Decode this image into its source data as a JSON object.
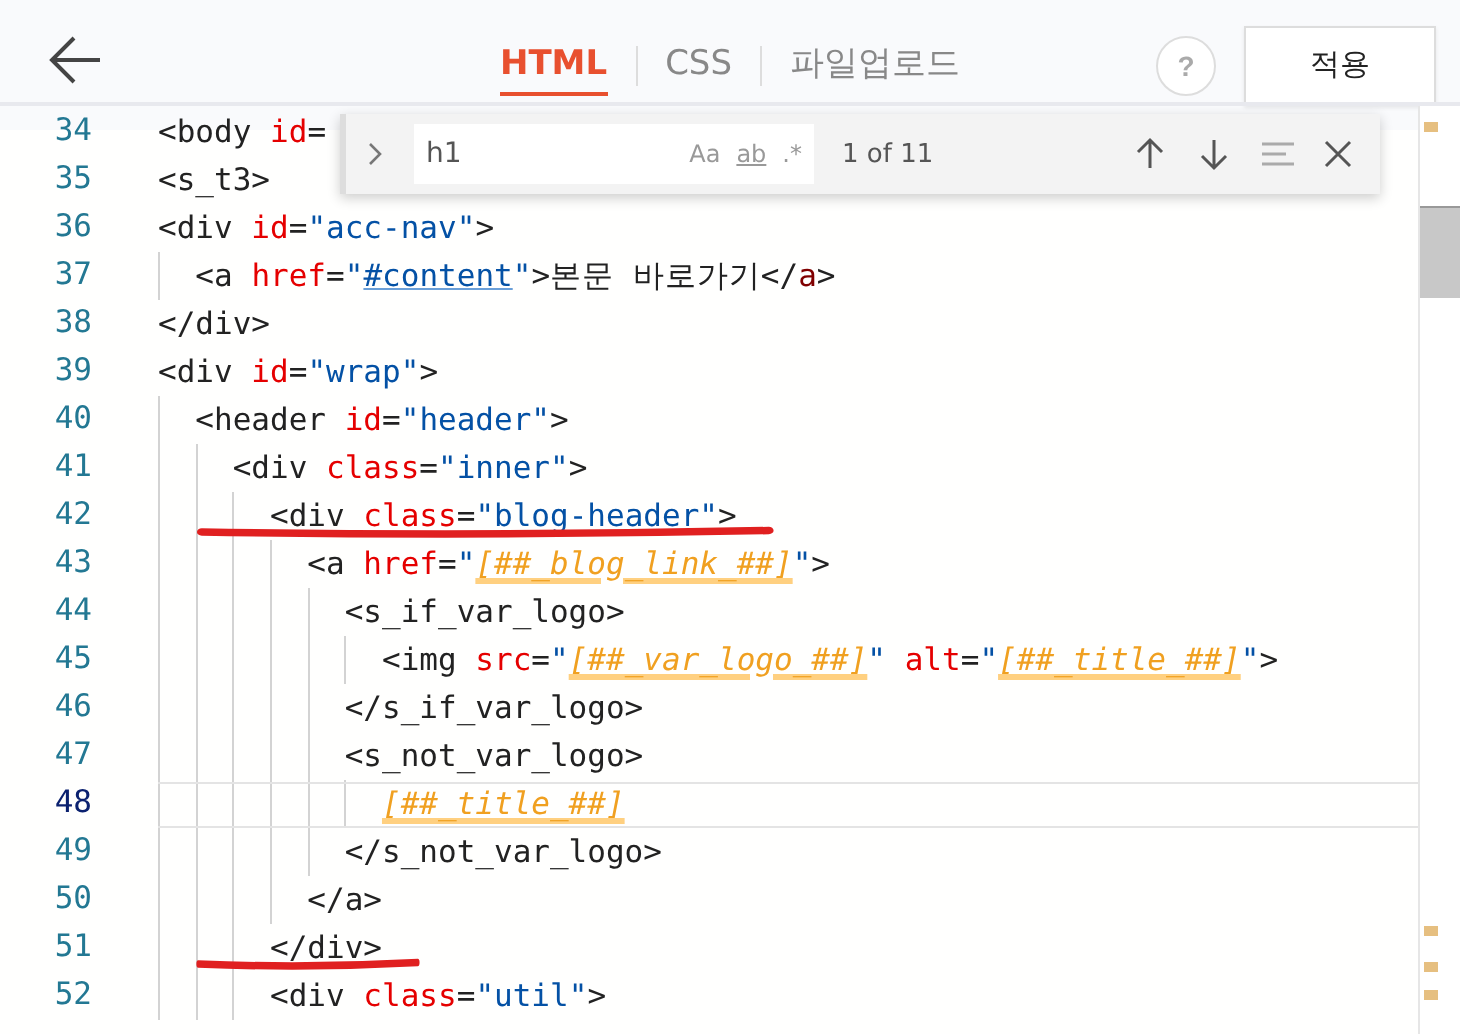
{
  "header": {
    "tabs": [
      {
        "label": "HTML",
        "selected": true
      },
      {
        "label": "CSS",
        "selected": false
      },
      {
        "label": "파일업로드",
        "selected": false
      }
    ],
    "help": "?",
    "apply_button": "적용"
  },
  "find_widget": {
    "value": "h1",
    "options": [
      "Aa",
      "ab",
      ".*"
    ],
    "result": "1 of 11"
  },
  "editor": {
    "lines": [
      {
        "number": "34",
        "current": false,
        "underlined": false,
        "tokens": [
          {
            "kind": "tag",
            "text": "<body"
          },
          {
            "kind": "attr",
            "text": " id"
          },
          {
            "kind": "punct",
            "text": "="
          }
        ]
      },
      {
        "number": "35",
        "current": false,
        "underlined": false,
        "tokens": [
          {
            "kind": "tag",
            "text": "<s_t3>"
          }
        ]
      },
      {
        "number": "36",
        "current": false,
        "underlined": false,
        "tokens": [
          {
            "kind": "tag",
            "text": "<div"
          },
          {
            "kind": "attr",
            "text": " id"
          },
          {
            "kind": "punct",
            "text": "="
          },
          {
            "kind": "str",
            "text": "\"acc-nav\""
          },
          {
            "kind": "tag",
            "text": ">"
          }
        ]
      },
      {
        "number": "37",
        "current": false,
        "underlined": false,
        "tokens": [
          {
            "kind": "tag",
            "text": "  <a"
          },
          {
            "kind": "attr",
            "text": " href"
          },
          {
            "kind": "punct",
            "text": "="
          },
          {
            "kind": "str",
            "text": "\""
          },
          {
            "kind": "link",
            "text": "#content"
          },
          {
            "kind": "str",
            "text": "\""
          },
          {
            "kind": "tag",
            "text": ">"
          },
          {
            "kind": "plain",
            "text": "본문 바로가기"
          },
          {
            "kind": "tag",
            "text": "</"
          },
          {
            "kind": "ctag",
            "text": "a"
          },
          {
            "kind": "tag",
            "text": ">"
          }
        ]
      },
      {
        "number": "38",
        "current": false,
        "underlined": false,
        "tokens": [
          {
            "kind": "tag",
            "text": "</div>"
          }
        ]
      },
      {
        "number": "39",
        "current": false,
        "underlined": false,
        "tokens": [
          {
            "kind": "tag",
            "text": "<div"
          },
          {
            "kind": "attr",
            "text": " id"
          },
          {
            "kind": "punct",
            "text": "="
          },
          {
            "kind": "str",
            "text": "\"wrap\""
          },
          {
            "kind": "tag",
            "text": ">"
          }
        ]
      },
      {
        "number": "40",
        "current": false,
        "underlined": false,
        "tokens": [
          {
            "kind": "tag",
            "text": "  <header"
          },
          {
            "kind": "attr",
            "text": " id"
          },
          {
            "kind": "punct",
            "text": "="
          },
          {
            "kind": "str",
            "text": "\"header\""
          },
          {
            "kind": "tag",
            "text": ">"
          }
        ]
      },
      {
        "number": "41",
        "current": false,
        "underlined": false,
        "tokens": [
          {
            "kind": "tag",
            "text": "    <div"
          },
          {
            "kind": "attr",
            "text": " class"
          },
          {
            "kind": "punct",
            "text": "="
          },
          {
            "kind": "str",
            "text": "\"inner\""
          },
          {
            "kind": "tag",
            "text": ">"
          }
        ]
      },
      {
        "number": "42",
        "current": false,
        "underlined": true,
        "tokens": [
          {
            "kind": "tag",
            "text": "      <div"
          },
          {
            "kind": "attr",
            "text": " class"
          },
          {
            "kind": "punct",
            "text": "="
          },
          {
            "kind": "str",
            "text": "\"blog-header\""
          },
          {
            "kind": "tag",
            "text": ">"
          }
        ]
      },
      {
        "number": "43",
        "current": false,
        "underlined": false,
        "tokens": [
          {
            "kind": "tag",
            "text": "        <a"
          },
          {
            "kind": "attr",
            "text": " href"
          },
          {
            "kind": "punct",
            "text": "="
          },
          {
            "kind": "str",
            "text": "\""
          },
          {
            "kind": "tpl",
            "text": "[##_blog_link_##]"
          },
          {
            "kind": "str",
            "text": "\""
          },
          {
            "kind": "tag",
            "text": ">"
          }
        ]
      },
      {
        "number": "44",
        "current": false,
        "underlined": false,
        "tokens": [
          {
            "kind": "tag",
            "text": "          <s_if_var_logo>"
          }
        ]
      },
      {
        "number": "45",
        "current": false,
        "underlined": false,
        "tokens": [
          {
            "kind": "tag",
            "text": "            <img"
          },
          {
            "kind": "attr",
            "text": " src"
          },
          {
            "kind": "punct",
            "text": "="
          },
          {
            "kind": "str",
            "text": "\""
          },
          {
            "kind": "tpl",
            "text": "[##_var_logo_##]"
          },
          {
            "kind": "str",
            "text": "\""
          },
          {
            "kind": "attr",
            "text": " alt"
          },
          {
            "kind": "punct",
            "text": "="
          },
          {
            "kind": "str",
            "text": "\""
          },
          {
            "kind": "tpl",
            "text": "[##_title_##]"
          },
          {
            "kind": "str",
            "text": "\""
          },
          {
            "kind": "tag",
            "text": ">"
          }
        ]
      },
      {
        "number": "46",
        "current": false,
        "underlined": false,
        "tokens": [
          {
            "kind": "tag",
            "text": "          </s_if_var_logo>"
          }
        ]
      },
      {
        "number": "47",
        "current": false,
        "underlined": false,
        "tokens": [
          {
            "kind": "tag",
            "text": "          <s_not_var_logo>"
          }
        ]
      },
      {
        "number": "48",
        "current": true,
        "underlined": false,
        "tokens": [
          {
            "kind": "tpl",
            "text": "            [##_title_##]"
          }
        ]
      },
      {
        "number": "49",
        "current": false,
        "underlined": false,
        "tokens": [
          {
            "kind": "tag",
            "text": "          </s_not_var_logo>"
          }
        ]
      },
      {
        "number": "50",
        "current": false,
        "underlined": false,
        "tokens": [
          {
            "kind": "tag",
            "text": "        </a>"
          }
        ]
      },
      {
        "number": "51",
        "current": false,
        "underlined": true,
        "tokens": [
          {
            "kind": "tag",
            "text": "      </div>"
          }
        ]
      },
      {
        "number": "52",
        "current": false,
        "underlined": false,
        "tokens": [
          {
            "kind": "tag",
            "text": "      <div"
          },
          {
            "kind": "attr",
            "text": " class"
          },
          {
            "kind": "punct",
            "text": "="
          },
          {
            "kind": "str",
            "text": "\"util\""
          },
          {
            "kind": "tag",
            "text": ">"
          }
        ]
      }
    ]
  }
}
